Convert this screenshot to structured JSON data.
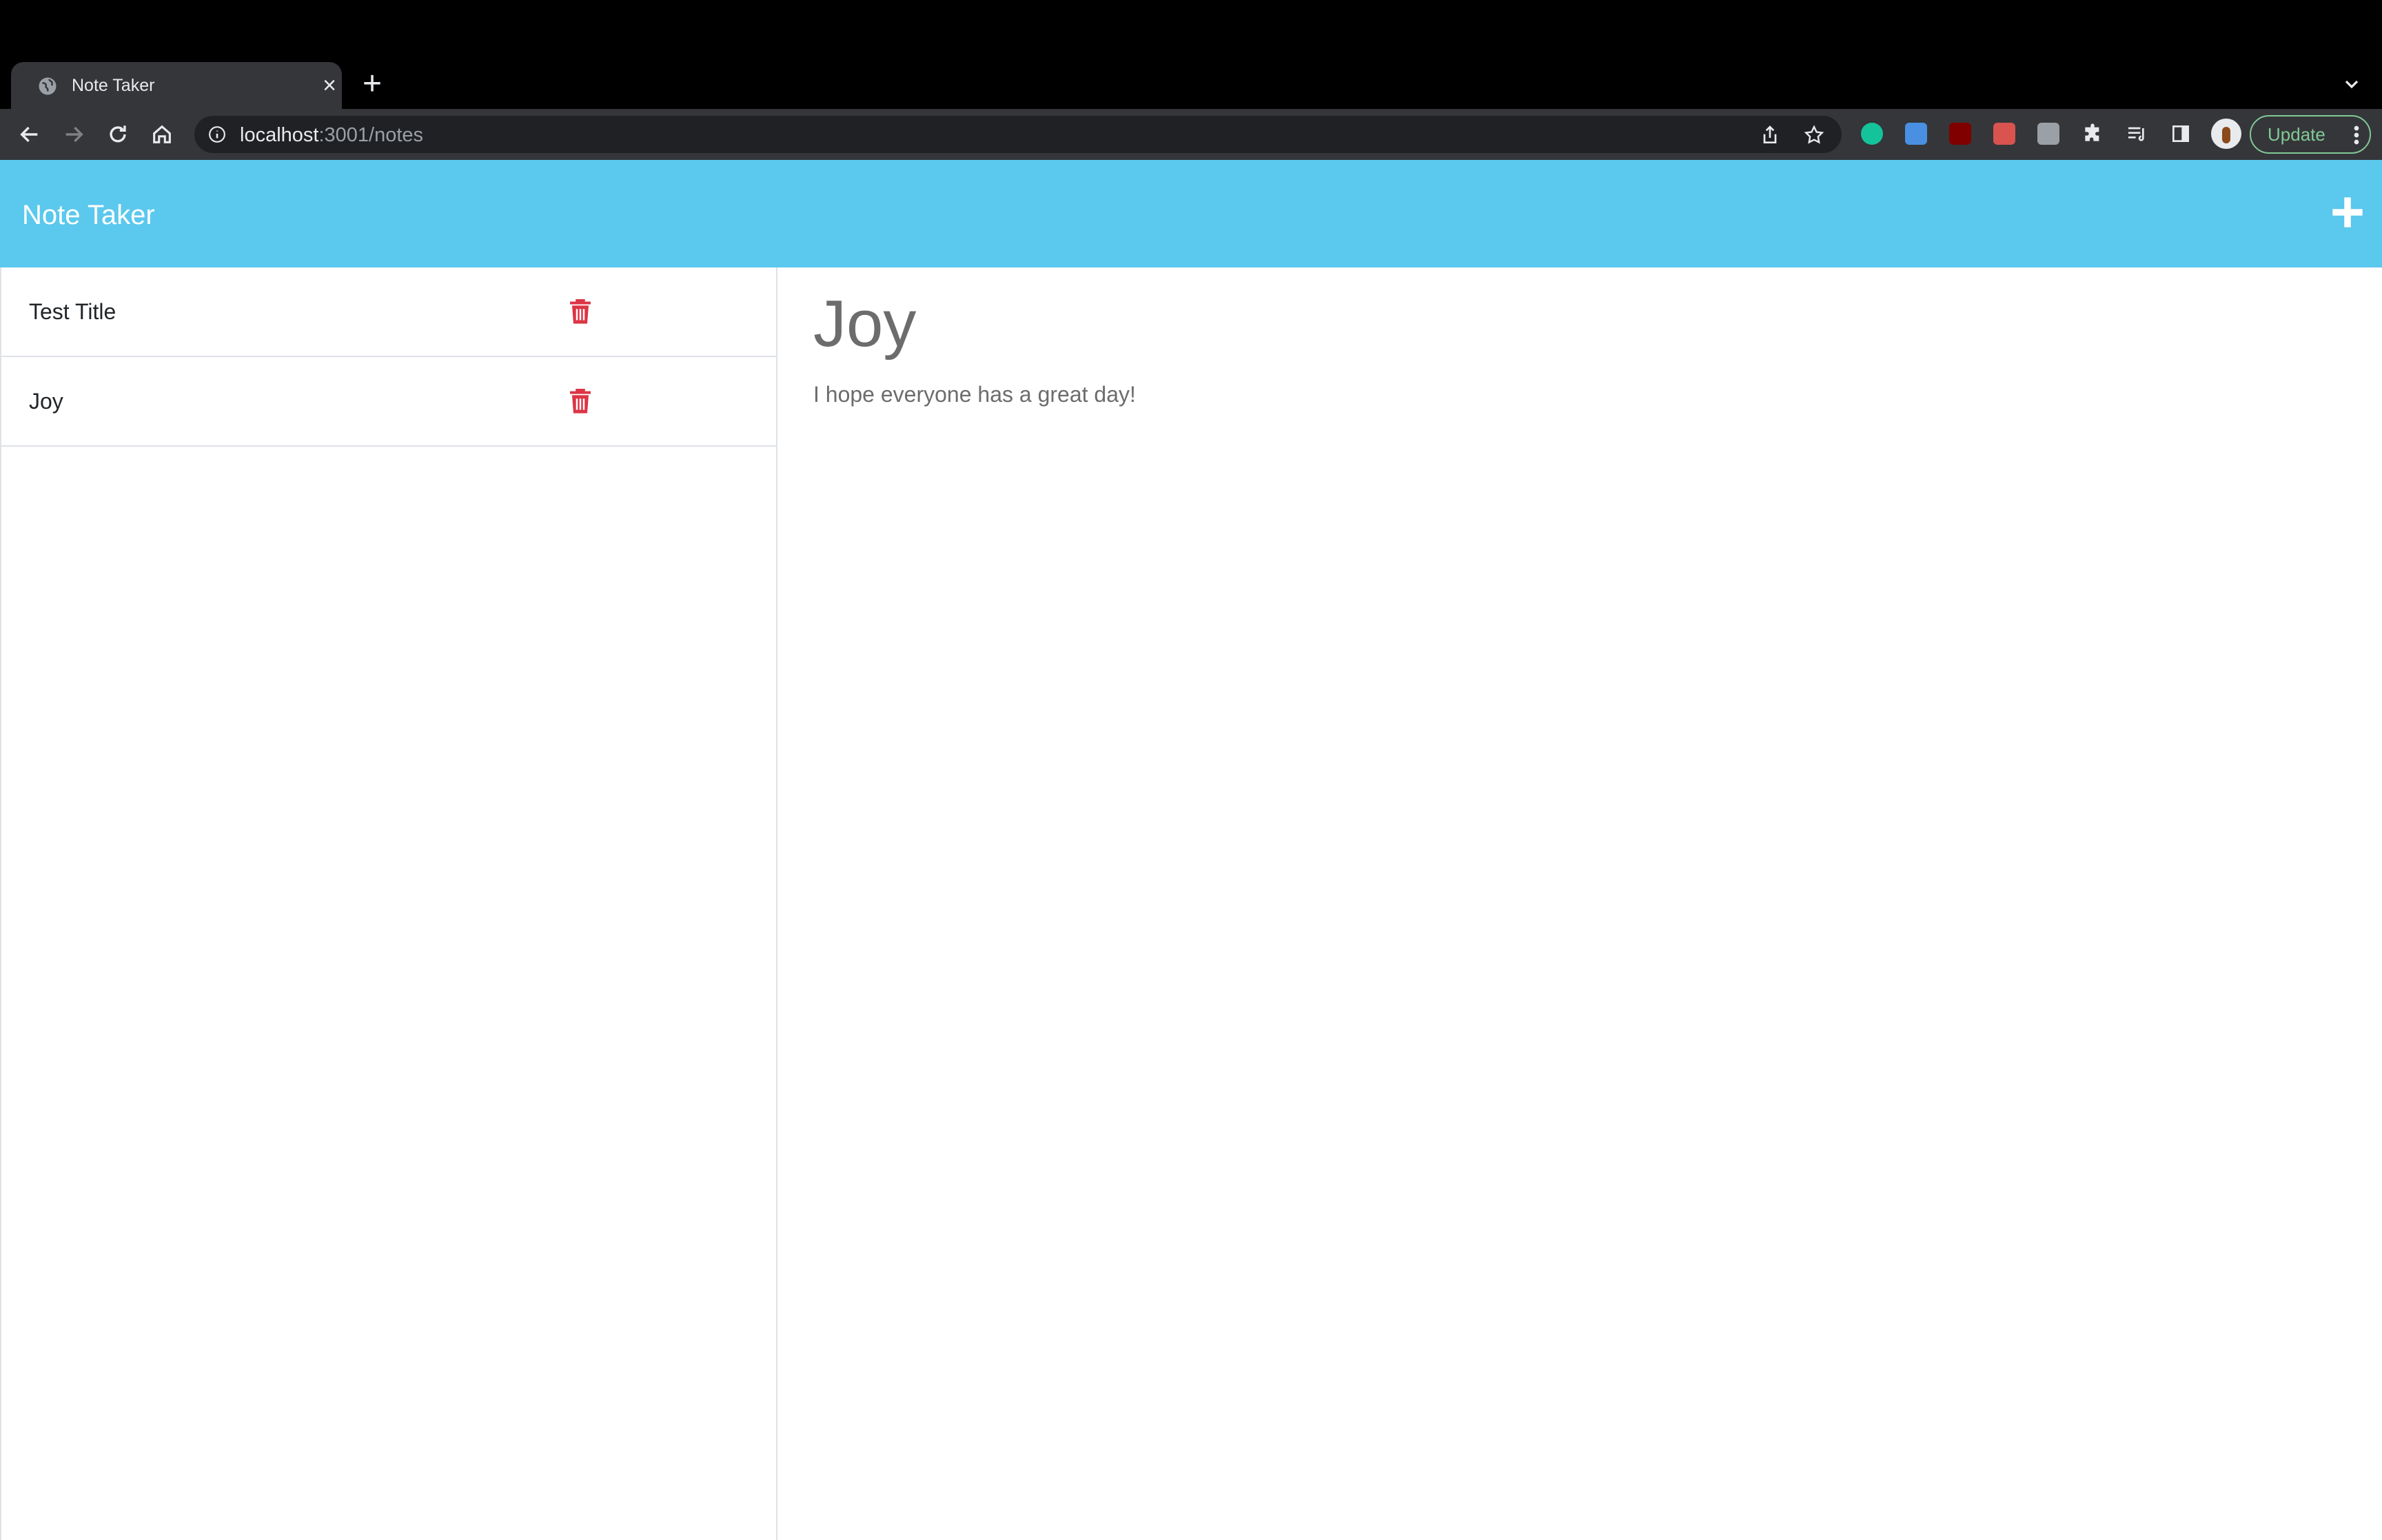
{
  "browser": {
    "tab_title": "Note Taker",
    "url_host": "localhost",
    "url_path": ":3001/notes",
    "update_label": "Update"
  },
  "app": {
    "brand": "Note Taker",
    "notes": [
      {
        "title": "Test Title"
      },
      {
        "title": "Joy"
      }
    ],
    "active_note": {
      "title": "Joy",
      "text": "I hope everyone has a great day!"
    }
  },
  "colors": {
    "navbar": "#5bc8ed",
    "trash": "#dc3545",
    "update_accent": "#81c995"
  },
  "icons": {
    "favicon": "globe-icon",
    "tab_close": "close-icon",
    "new_tab": "plus-icon",
    "back": "arrow-left-icon",
    "forward": "arrow-right-icon",
    "reload": "reload-icon",
    "home": "home-icon",
    "site_info": "info-icon",
    "share": "share-icon",
    "bookmark": "star-icon",
    "extensions": "puzzle-icon",
    "reading_list": "reading-list-icon",
    "side_panel": "side-panel-icon",
    "profile": "avatar",
    "menu": "kebab-menu-icon",
    "add_note": "plus-icon",
    "delete_note": "trash-icon"
  }
}
